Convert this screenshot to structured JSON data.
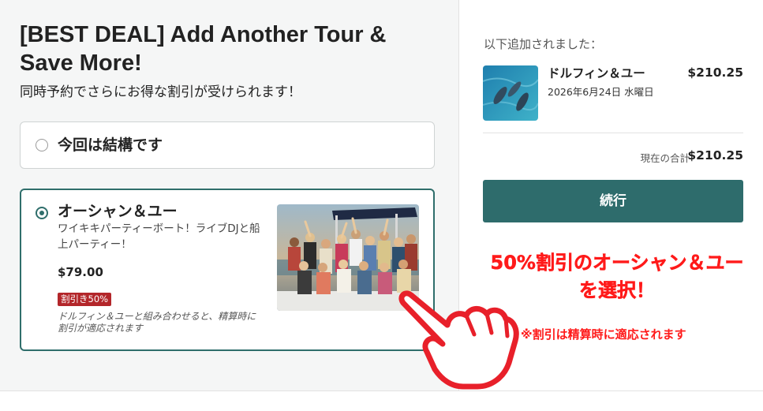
{
  "left": {
    "title": "[BEST DEAL] Add Another Tour & Save More!",
    "subtitle": "同時予約でさらにお得な割引が受けられます！",
    "skip_option": {
      "label": "今回は結構です"
    },
    "tour_option": {
      "name": "オーシャン＆ユー",
      "description": "ワイキキパーティーボート！ライブDJと船上パーティー！",
      "price": "$79.00",
      "discount_badge": "割引き50%",
      "discount_note": "ドルフィン＆ユーと組み合わせると、精算時に割引が適応されます"
    }
  },
  "cart": {
    "added_label": "以下追加されました：",
    "item": {
      "name": "ドルフィン＆ユー",
      "date": "2026年6月24日 水曜日",
      "price": "$210.25"
    },
    "total_label": "現在の合計",
    "total_value": "$210.25",
    "continue_label": "続行"
  },
  "annotation": {
    "line1": "50%割引のオーシャン＆ユー",
    "line2": "を選択！",
    "note": "※割引は精算時に適応されます",
    "color": "#ff1a1a"
  },
  "colors": {
    "accent": "#2e6c6c",
    "badge": "#b3262a"
  }
}
